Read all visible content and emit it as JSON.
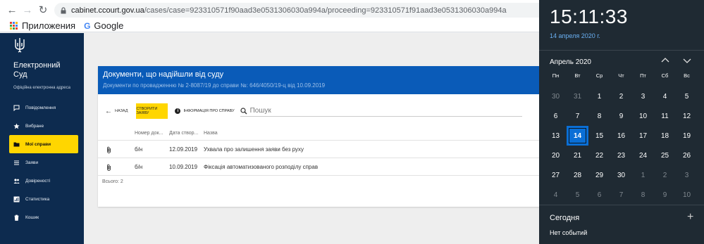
{
  "browser": {
    "url_host": "cabinet.ccourt.gov.ua",
    "url_path": "/cases/case=923310571f90aad3e0531306030a994a/proceeding=923310571f91aad3e0531306030a994a",
    "bookmarks": [
      {
        "label": "Приложения",
        "icon": "apps-grid-icon"
      },
      {
        "label": "Google",
        "icon": "google-icon"
      }
    ]
  },
  "sidebar": {
    "brand_line1": "Електронний",
    "brand_line2": "Суд",
    "brand_sub": "Офіційна електронна адреса",
    "items": [
      {
        "label": "Повідомлення",
        "icon": "message-icon",
        "active": false
      },
      {
        "label": "Вибране",
        "icon": "star-icon",
        "active": false
      },
      {
        "label": "Мої справи",
        "icon": "folder-icon",
        "active": true
      },
      {
        "label": "Заяви",
        "icon": "list-icon",
        "active": false
      },
      {
        "label": "Довіреності",
        "icon": "people-icon",
        "active": false
      },
      {
        "label": "Статистика",
        "icon": "chart-icon",
        "active": false
      },
      {
        "label": "Кошик",
        "icon": "trash-icon",
        "active": false
      }
    ]
  },
  "card": {
    "title": "Документи, що надійшли від суду",
    "subtitle": "Документи по провадженню № 2-8087/19 до справи №: 646/4050/19-ц від 10.09.2019",
    "back_label": "НАЗАД",
    "create_label": "СТВОРИТИ ЗАЯВУ",
    "info_label": "ІНФОРМАЦІЯ ПРО СПРАВУ",
    "search_placeholder": "Пошук",
    "columns": [
      "Номер док...",
      "Дата створ...",
      "Назва"
    ],
    "rows": [
      {
        "number": "б/н",
        "date": "12.09.2019",
        "title": "Ухвала про залишення заяви без руху"
      },
      {
        "number": "б/н",
        "date": "10.09.2019",
        "title": "Фіксація автоматизованого розподілу справ"
      }
    ],
    "total": "Всього: 2"
  },
  "flyout": {
    "time": "15:11:33",
    "date": "14 апреля 2020 г.",
    "month": "Апрель 2020",
    "weekdays": [
      "Пн",
      "Вт",
      "Ср",
      "Чт",
      "Пт",
      "Сб",
      "Вс"
    ],
    "weeks": [
      [
        "30",
        "31",
        "1",
        "2",
        "3",
        "4",
        "5"
      ],
      [
        "6",
        "7",
        "8",
        "9",
        "10",
        "11",
        "12"
      ],
      [
        "13",
        "14",
        "15",
        "16",
        "17",
        "18",
        "19"
      ],
      [
        "20",
        "21",
        "22",
        "23",
        "24",
        "25",
        "26"
      ],
      [
        "27",
        "28",
        "29",
        "30",
        "1",
        "2",
        "3"
      ],
      [
        "4",
        "5",
        "6",
        "7",
        "8",
        "9",
        "10"
      ]
    ],
    "today_value": "14",
    "today_label": "Сегодня",
    "no_events": "Нет событий"
  }
}
